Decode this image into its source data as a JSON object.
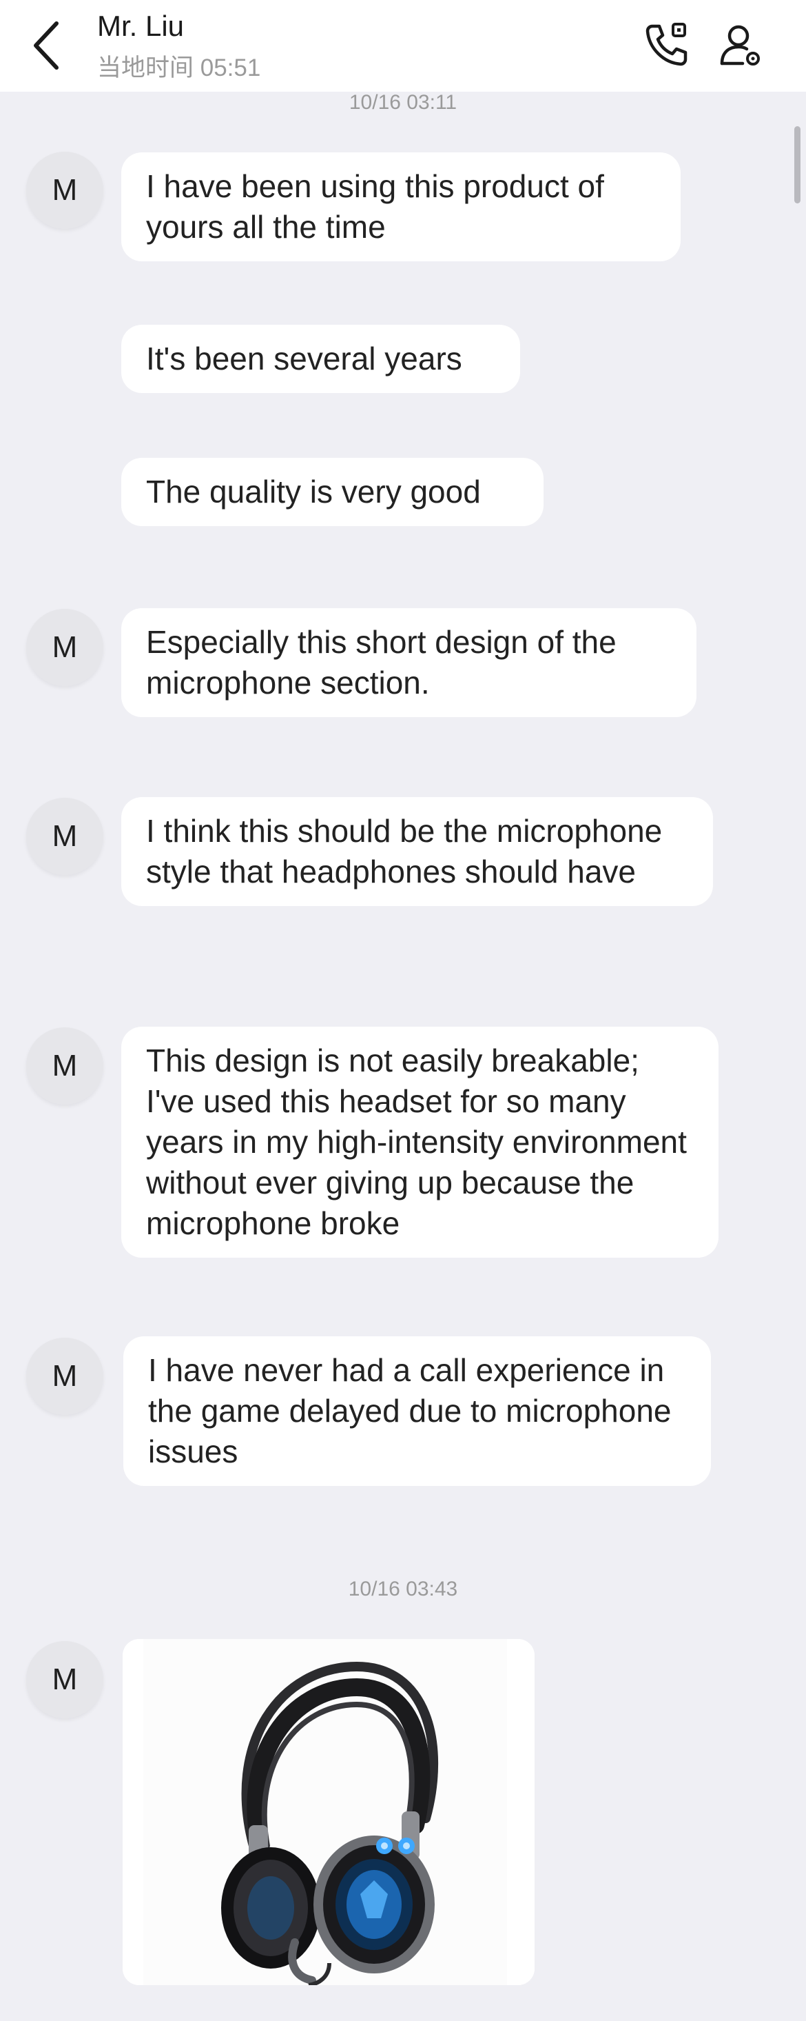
{
  "header": {
    "contact_name": "Mr. Liu",
    "local_time": "当地时间 05:51",
    "icons": [
      "back-icon",
      "voice-call-icon",
      "profile-settings-icon"
    ]
  },
  "separators": [
    "10/16 03:11",
    "10/16 03:43"
  ],
  "messages": [
    {
      "sender_avatar": "M",
      "text": "I have been using this product of yours all the time"
    },
    {
      "sender_avatar": "",
      "text": "It's been several years"
    },
    {
      "sender_avatar": "",
      "text": "The quality is very good"
    },
    {
      "sender_avatar": "M",
      "text": "Especially this short design of the microphone section."
    },
    {
      "sender_avatar": "M",
      "text": "I think this should be the microphone style that headphones should have"
    },
    {
      "sender_avatar": "M",
      "text": "This design is not easily breakable; I've used this headset for so many years in my high-intensity environment without ever giving up because the microphone broke"
    },
    {
      "sender_avatar": "M",
      "text": "I have never had a call experience in the game delayed due to microphone issues"
    },
    {
      "sender_avatar": "M",
      "type": "image",
      "image_subject": "gaming-headset-image"
    }
  ],
  "colors": {
    "page_background": "#efeff4",
    "header_background": "#ffffff",
    "bubble_background": "#ffffff",
    "secondary_text": "#9a9a9a",
    "headset_glow": "#3fa8ff"
  }
}
